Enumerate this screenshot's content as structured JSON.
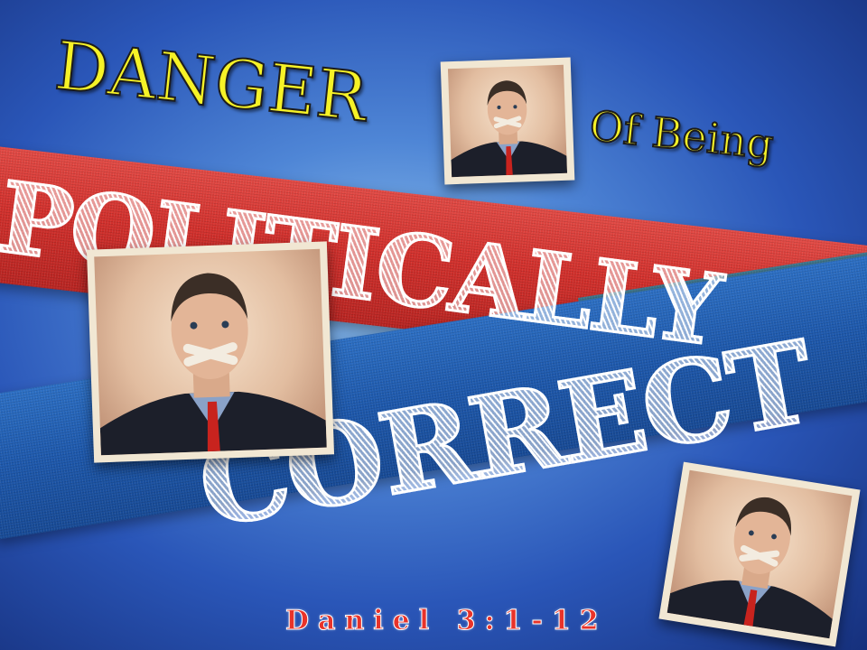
{
  "slide": {
    "title_danger": "DANGER",
    "title_of_being": "Of Being",
    "word_politically": "POLITICALLY",
    "word_correct": "CORRECT",
    "reference": "Daniel 3:1-12",
    "colors": {
      "background": "#2a56b8",
      "red_tape": "#d2302c",
      "blue_tape": "#1d58ac",
      "title_yellow": "#f6f227",
      "reference_red": "#e8332a"
    },
    "photos": [
      {
        "name": "man-taped-mouth-photo",
        "description_icon": "person-taped-mouth-icon"
      },
      {
        "name": "man-taped-mouth-photo",
        "description_icon": "person-taped-mouth-icon"
      },
      {
        "name": "man-taped-mouth-photo",
        "description_icon": "person-taped-mouth-icon"
      }
    ]
  }
}
